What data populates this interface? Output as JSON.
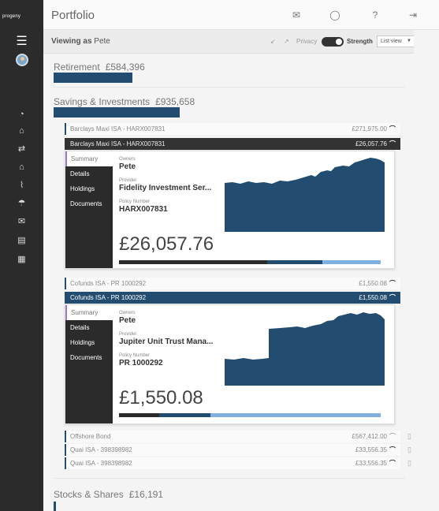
{
  "brand": "progeny",
  "topbar": {
    "title": "Portfolio",
    "icons": [
      "envelope-icon",
      "user-icon",
      "question-icon",
      "sign-out-icon"
    ]
  },
  "viewbar": {
    "label": "Viewing as",
    "user": "Pete",
    "privacy_label": "Privacy",
    "strength_label": "Strength",
    "view_select": "List view"
  },
  "sidebar_icons": [
    "menu-icon",
    "avatar",
    "dashboard-icon",
    "bank-icon",
    "transfer-icon",
    "home-icon",
    "chart-icon",
    "umbrella-icon",
    "mail-icon",
    "document-icon",
    "calendar-icon"
  ],
  "sections": {
    "retirement": {
      "title": "Retirement",
      "value": "£584,396"
    },
    "savings": {
      "title": "Savings & Investments",
      "value": "£935,658"
    },
    "stocks": {
      "title": "Stocks & Shares",
      "value": "£16,191"
    }
  },
  "rows": {
    "r1": {
      "name": "Barclays Maxi ISA - HARX007831",
      "amount": "£271,975.00"
    },
    "r2": {
      "name": "Barclays Maxi ISA - HARX007831",
      "amount": "£26,057.76"
    },
    "r3": {
      "name": "Cofunds ISA - PR 1000292",
      "amount": "£1,550.08"
    },
    "r4": {
      "name": "Cofunds ISA - PR 1000292",
      "amount": "£1,550.08"
    },
    "r5": {
      "name": "Offshore Bond",
      "amount": "£567,412.00"
    },
    "r6": {
      "name": "Quai ISA - 398398982",
      "amount": "£33,556.35"
    },
    "r7": {
      "name": "Quai ISA - 398398982",
      "amount": "£33,556.35"
    }
  },
  "cards": {
    "c1": {
      "tabs": [
        "Summary",
        "Details",
        "Holdings",
        "Documents"
      ],
      "owners_label": "Owners",
      "owners": "Pete",
      "provider_label": "Provider",
      "provider": "Fidelity Investment Ser...",
      "policy_label": "Policy Number",
      "policy": "HARX007831",
      "value": "£26,057.76",
      "strength": [
        0.5,
        0.23,
        0.27
      ]
    },
    "c2": {
      "tabs": [
        "Summary",
        "Details",
        "Holdings",
        "Documents"
      ],
      "owners_label": "Owners",
      "owners": "Pete",
      "provider_label": "Provider",
      "provider": "Jupiter Unit Trust Mana...",
      "policy_label": "Policy Number",
      "policy": "PR 1000292",
      "value": "£1,550.08",
      "strength": [
        0.19,
        0.19,
        0.62
      ]
    }
  },
  "colors": {
    "navy": "#234d70",
    "dark": "#2b2b2b",
    "light_blue": "#7fb0e0",
    "accent": "#9c7bc4"
  }
}
